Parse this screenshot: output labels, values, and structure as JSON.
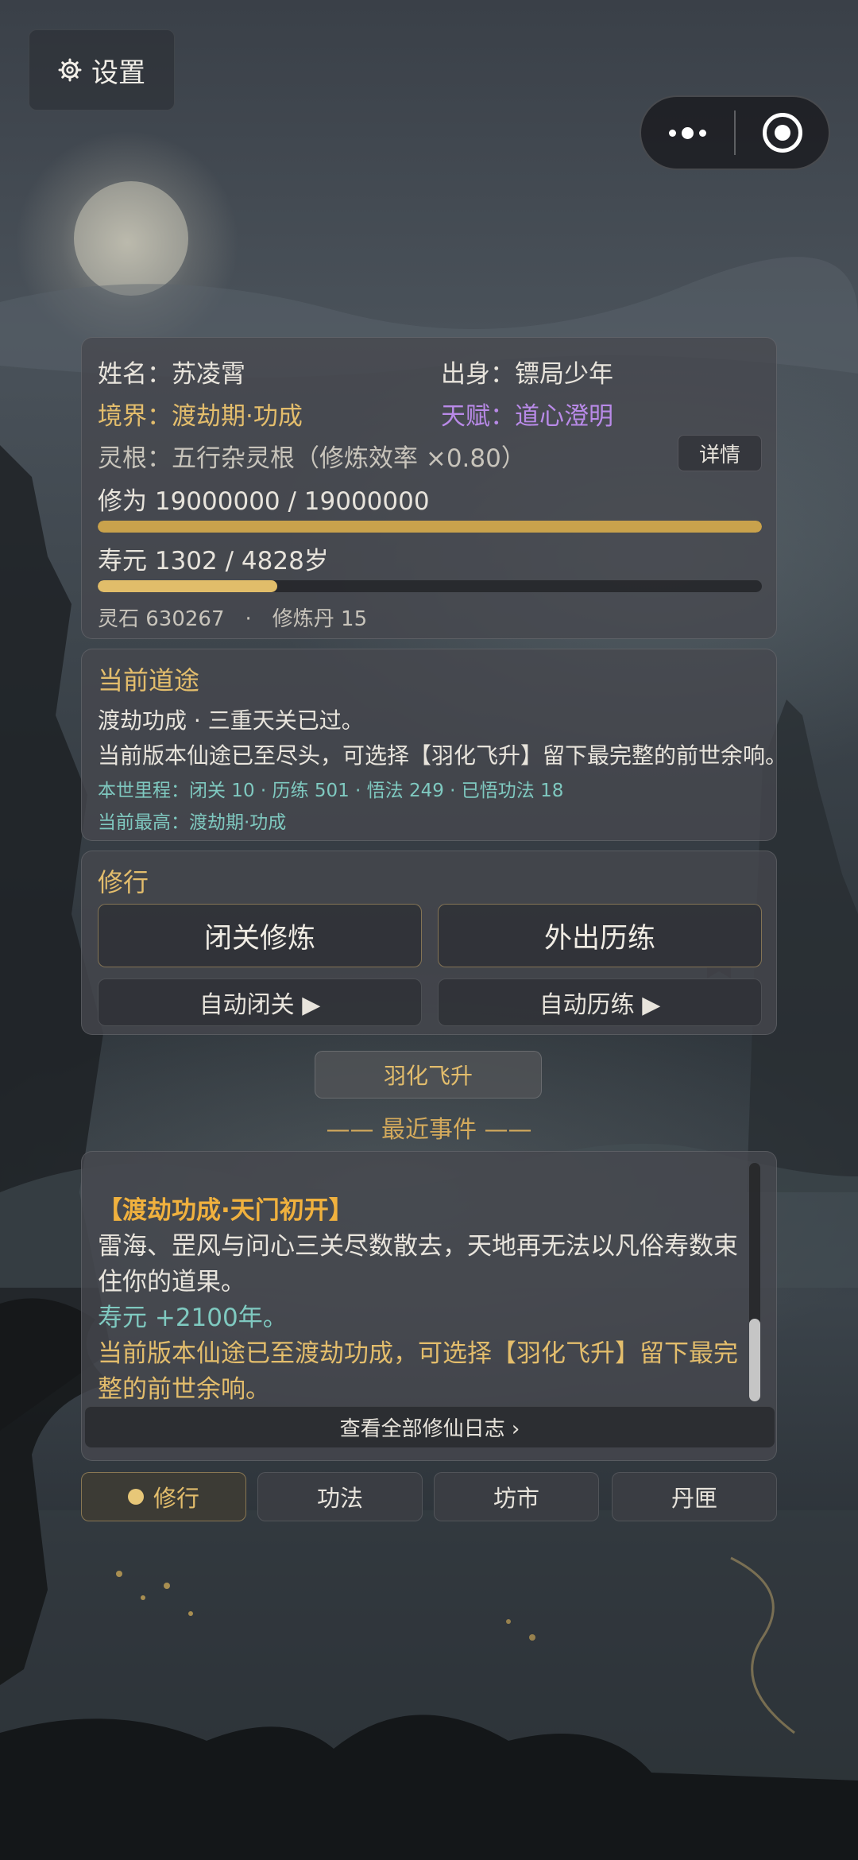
{
  "settings": {
    "label": "设置"
  },
  "status": {
    "name_label": "姓名：",
    "name": "苏凌霄",
    "origin_label": "出身：",
    "origin": "镖局少年",
    "realm_label": "境界：",
    "realm": "渡劫期·功成",
    "talent_label": "天赋：",
    "talent": "道心澄明",
    "root_label": "灵根：",
    "root": "五行杂灵根（修炼效率 ×0.80）",
    "detail_button": "详情",
    "cultivation_text": "修为 19000000 / 19000000",
    "cultivation_progress": 1.0,
    "lifespan_text": "寿元 1302 / 4828岁",
    "lifespan_progress": 0.27,
    "resources_text": "灵石 630267　·　修炼丹 15",
    "colors": {
      "cultivation_bar": "#c9a24c",
      "lifespan_bar": "#e1bd6a"
    }
  },
  "path": {
    "title": "当前道途",
    "line1": "渡劫功成 · 三重天关已过。",
    "line2": "当前版本仙途已至尽头，可选择【羽化飞升】留下最完整的前世余响。",
    "milestones": "本世里程：闭关 10 · 历练 501 · 悟法 249 · 已悟功法 18",
    "highest": "当前最高：渡劫期·功成"
  },
  "practice": {
    "title": "修行",
    "seclusion_button": "闭关修炼",
    "travel_button": "外出历练",
    "auto_seclusion_button": "自动闭关 ▶",
    "auto_travel_button": "自动历练 ▶"
  },
  "ascend_button": "羽化飞升",
  "events": {
    "heading": "—— 最近事件 ——",
    "event_title": "【渡劫功成·天门初开】",
    "event_body": "雷海、罡风与问心三关尽数散去，天地再无法以凡俗寿数束住你的道果。",
    "event_gain": "寿元 +2100年。",
    "event_note": "当前版本仙途已至渡劫功成，可选择【羽化飞升】留下最完整的前世余响。",
    "view_all": "查看全部修仙日志 ›"
  },
  "tabs": [
    {
      "label": "修行",
      "active": true
    },
    {
      "label": "功法",
      "active": false
    },
    {
      "label": "坊市",
      "active": false
    },
    {
      "label": "丹匣",
      "active": false
    }
  ]
}
